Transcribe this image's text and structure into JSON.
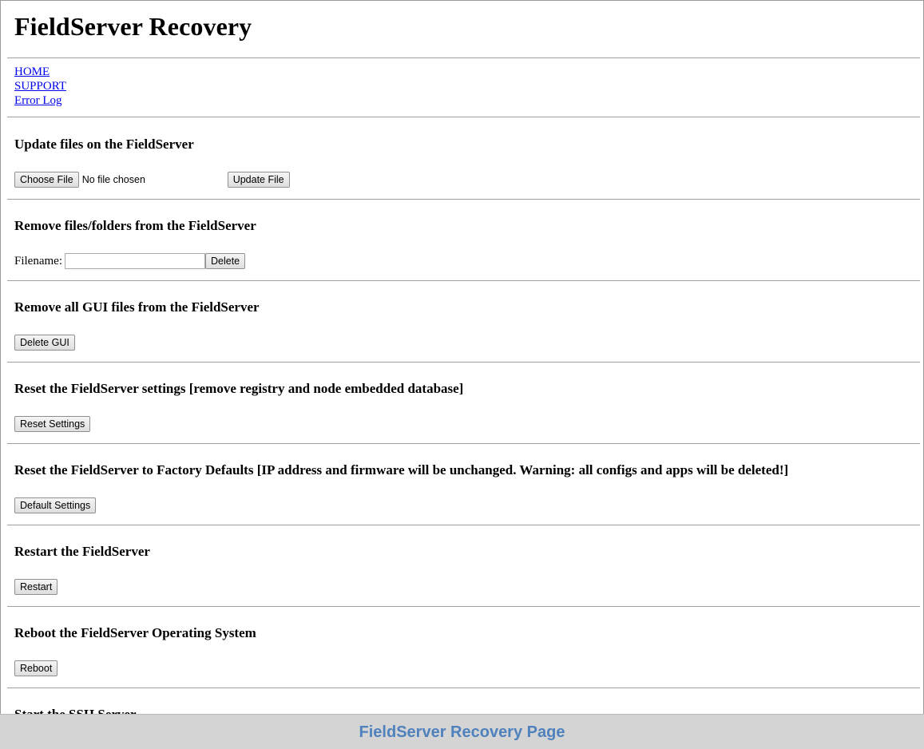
{
  "header": {
    "title": "FieldServer Recovery"
  },
  "nav": {
    "items": [
      {
        "label": "HOME"
      },
      {
        "label": "SUPPORT"
      },
      {
        "label": "Error Log"
      }
    ]
  },
  "sections": {
    "update": {
      "heading": "Update files on the FieldServer",
      "choose_label": "Choose File",
      "no_file_text": "No file chosen",
      "submit_label": "Update File"
    },
    "remove": {
      "heading": "Remove files/folders from the FieldServer",
      "field_label": "Filename:",
      "field_value": "",
      "submit_label": "Delete"
    },
    "remove_gui": {
      "heading": "Remove all GUI files from the FieldServer",
      "submit_label": "Delete GUI"
    },
    "reset_settings": {
      "heading": "Reset the FieldServer settings [remove registry and node embedded database]",
      "submit_label": "Reset Settings"
    },
    "factory_defaults": {
      "heading": "Reset the FieldServer to Factory Defaults [IP address and firmware will be unchanged. Warning: all configs and apps will be deleted!]",
      "submit_label": "Default Settings"
    },
    "restart": {
      "heading": "Restart the FieldServer",
      "submit_label": "Restart"
    },
    "reboot": {
      "heading": "Reboot the FieldServer Operating System",
      "submit_label": "Reboot"
    },
    "ssh": {
      "heading": "Start the SSH Server"
    }
  },
  "footer": {
    "caption": "FieldServer Recovery Page"
  },
  "colors": {
    "link": "#0000ee",
    "footer_bg": "#d4d4d4",
    "footer_text": "#4f81bd"
  }
}
